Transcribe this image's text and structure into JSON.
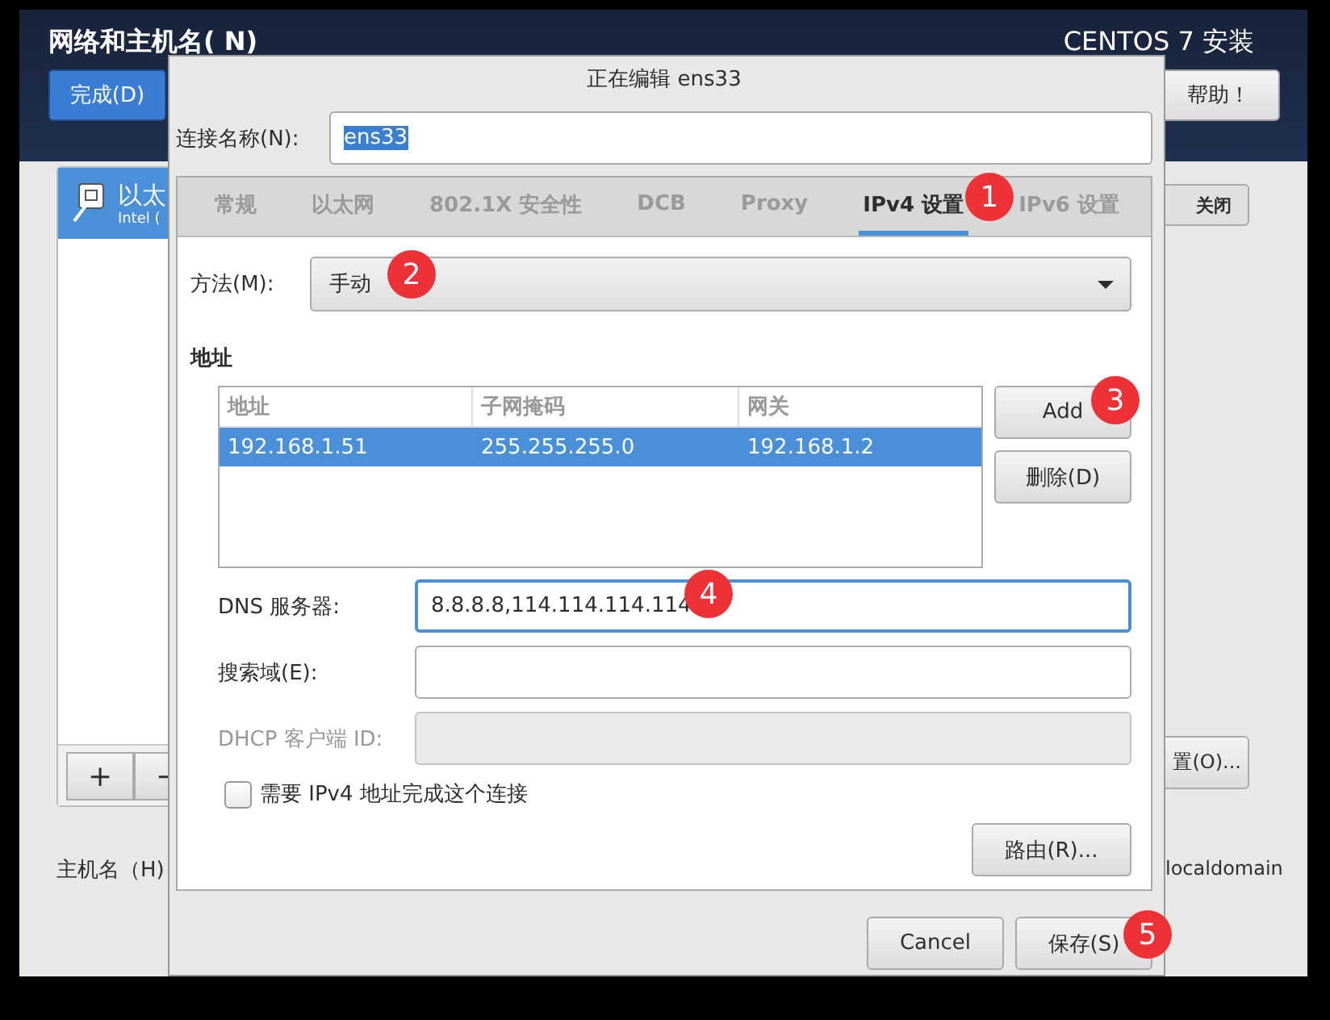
{
  "installer": {
    "title": "网络和主机名( N)",
    "product": "CENTOS 7 安装",
    "done_button": "完成(D)",
    "help_button": "帮助！",
    "devices": [
      {
        "name": "以太",
        "detail": "Intel (",
        "selected": true
      }
    ],
    "add_button": "+",
    "remove_button": "−",
    "switch": {
      "label": "关闭",
      "on": false
    },
    "configure_button": "置(O)...",
    "hostname_label": "主机名（H)",
    "hostname_value": "localdomain"
  },
  "dialog": {
    "title": "正在编辑 ens33",
    "connection_name": {
      "label": "连接名称(N):",
      "value": "ens33"
    },
    "tabs": [
      {
        "label": "常规",
        "selected": false
      },
      {
        "label": "以太网",
        "selected": false
      },
      {
        "label": "802.1X 安全性",
        "selected": false
      },
      {
        "label": "DCB",
        "selected": false
      },
      {
        "label": "Proxy",
        "selected": false
      },
      {
        "label": "IPv4 设置",
        "selected": true
      },
      {
        "label": "IPv6 设置",
        "selected": false
      }
    ],
    "method": {
      "label": "方法(M):",
      "value": "手动"
    },
    "address_heading": "地址",
    "address_table": {
      "columns": [
        "地址",
        "子网掩码",
        "网关"
      ],
      "rows": [
        {
          "cells": [
            "192.168.1.51",
            "255.255.255.0",
            "192.168.1.2"
          ],
          "selected": true
        }
      ]
    },
    "add_button": "Add",
    "delete_button": "删除(D)",
    "fields": [
      {
        "label": "DNS 服务器:",
        "value": "8.8.8.8,114.114.114.114",
        "focused": true,
        "disabled": false
      },
      {
        "label": "搜索域(E):",
        "focused": false,
        "disabled": false
      },
      {
        "label": "DHCP 客户端 ID:",
        "focused": false,
        "disabled": true
      }
    ],
    "require_ipv4": {
      "label": "需要 IPv4 地址完成这个连接",
      "checked": false
    },
    "routes_button": "路由(R)...",
    "cancel_button": "Cancel",
    "save_button": "保存(S)"
  },
  "annotations": [
    {
      "number": "1"
    },
    {
      "number": "2"
    },
    {
      "number": "3"
    },
    {
      "number": "4"
    },
    {
      "number": "5"
    }
  ]
}
